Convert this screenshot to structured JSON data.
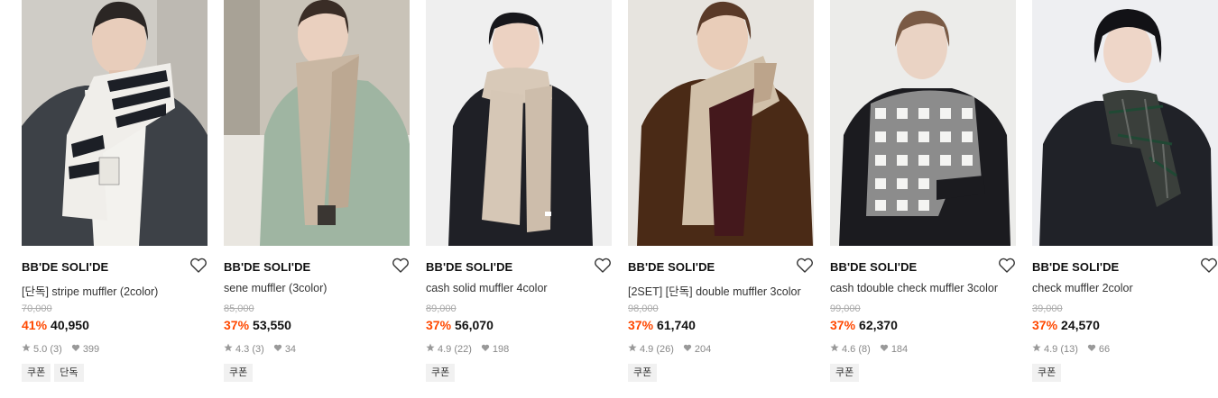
{
  "colors": {
    "discount": "#ff4800",
    "tag_bg": "#f1f1f1",
    "meta_gray": "#888888"
  },
  "icons": {
    "wishlist": "heart-outline-icon",
    "rating": "star-icon",
    "likes": "heart-filled-icon"
  },
  "products": [
    {
      "brand": "BB'DE SOLI'DE",
      "name": "[단독] stripe muffler (2color)",
      "original_price": "70,000",
      "discount": "41%",
      "price": "40,950",
      "rating": "5.0",
      "reviews": "(3)",
      "likes": "399",
      "tags": [
        "쿠폰",
        "단독"
      ],
      "scarf_color": "#e9e7e0"
    },
    {
      "brand": "BB'DE SOLI'DE",
      "name": "sene muffler (3color)",
      "original_price": "85,000",
      "discount": "37%",
      "price": "53,550",
      "rating": "4.3",
      "reviews": "(3)",
      "likes": "34",
      "tags": [
        "쿠폰"
      ],
      "scarf_color": "#c8b8a4"
    },
    {
      "brand": "BB'DE SOLI'DE",
      "name": "cash solid muffler 4color",
      "original_price": "89,000",
      "discount": "37%",
      "price": "56,070",
      "rating": "4.9",
      "reviews": "(22)",
      "likes": "198",
      "tags": [
        "쿠폰"
      ],
      "scarf_color": "#d9cbbb"
    },
    {
      "brand": "BB'DE SOLI'DE",
      "name": "[2SET] [단독] double muffler 3color",
      "original_price": "98,000",
      "discount": "37%",
      "price": "61,740",
      "rating": "4.9",
      "reviews": "(26)",
      "likes": "204",
      "tags": [
        "쿠폰"
      ],
      "scarf_color": "#4a1c1e"
    },
    {
      "brand": "BB'DE SOLI'DE",
      "name": "cash tdouble check muffler 3color",
      "original_price": "99,000",
      "discount": "37%",
      "price": "62,370",
      "rating": "4.6",
      "reviews": "(8)",
      "likes": "184",
      "tags": [
        "쿠폰"
      ],
      "scarf_color": "#5a5a5a"
    },
    {
      "brand": "BB'DE SOLI'DE",
      "name": "check muffler 2color",
      "original_price": "39,000",
      "discount": "37%",
      "price": "24,570",
      "rating": "4.9",
      "reviews": "(13)",
      "likes": "66",
      "tags": [
        "쿠폰"
      ],
      "scarf_color": "#2f3a33"
    }
  ]
}
